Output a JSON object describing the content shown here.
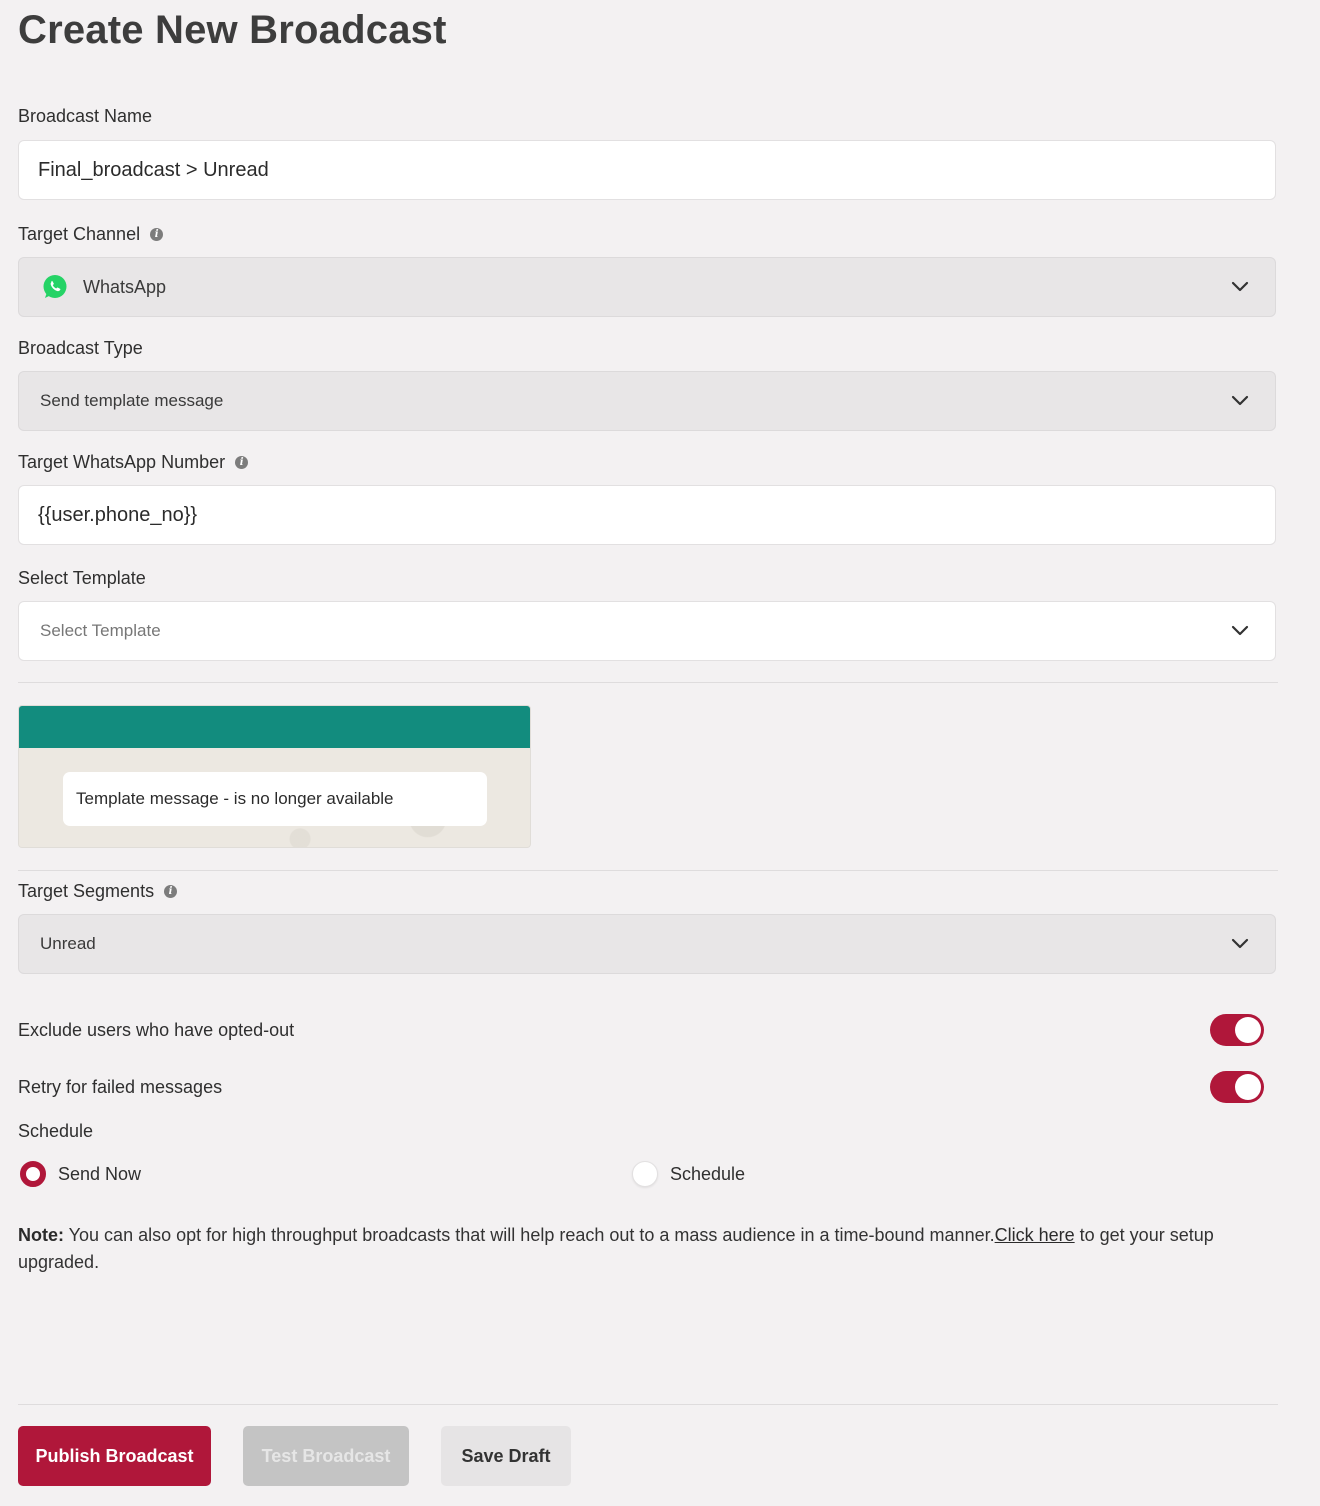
{
  "page": {
    "title": "Create New Broadcast"
  },
  "broadcast_name": {
    "label": "Broadcast Name",
    "value": "Final_broadcast > Unread"
  },
  "target_channel": {
    "label": "Target Channel",
    "value": "WhatsApp",
    "icon": "whatsapp-icon",
    "brand_color": "#25d366"
  },
  "broadcast_type": {
    "label": "Broadcast Type",
    "value": "Send template message"
  },
  "target_number": {
    "label": "Target WhatsApp Number",
    "value": "{{user.phone_no}}"
  },
  "select_template": {
    "label": "Select Template",
    "placeholder": "Select Template"
  },
  "preview": {
    "header_color": "#128c7e",
    "message": "Template message - is no longer available"
  },
  "target_segments": {
    "label": "Target Segments",
    "value": "Unread"
  },
  "toggles": {
    "exclude_opted_out": {
      "label": "Exclude users who have opted-out",
      "on": true
    },
    "retry_failed": {
      "label": "Retry for failed messages",
      "on": true
    }
  },
  "schedule": {
    "label": "Schedule",
    "options": [
      {
        "label": "Send Now",
        "selected": true
      },
      {
        "label": "Schedule",
        "selected": false
      }
    ]
  },
  "note": {
    "prefix": "Note:",
    "text": " You can also opt for high throughput broadcasts that will help reach out to a mass audience in a time-bound manner.",
    "link": "Click here",
    "suffix": " to get your setup upgraded."
  },
  "buttons": {
    "publish": "Publish Broadcast",
    "test": "Test Broadcast",
    "save_draft": "Save Draft"
  },
  "colors": {
    "accent": "#b0173a",
    "background": "#f3f1f2"
  }
}
